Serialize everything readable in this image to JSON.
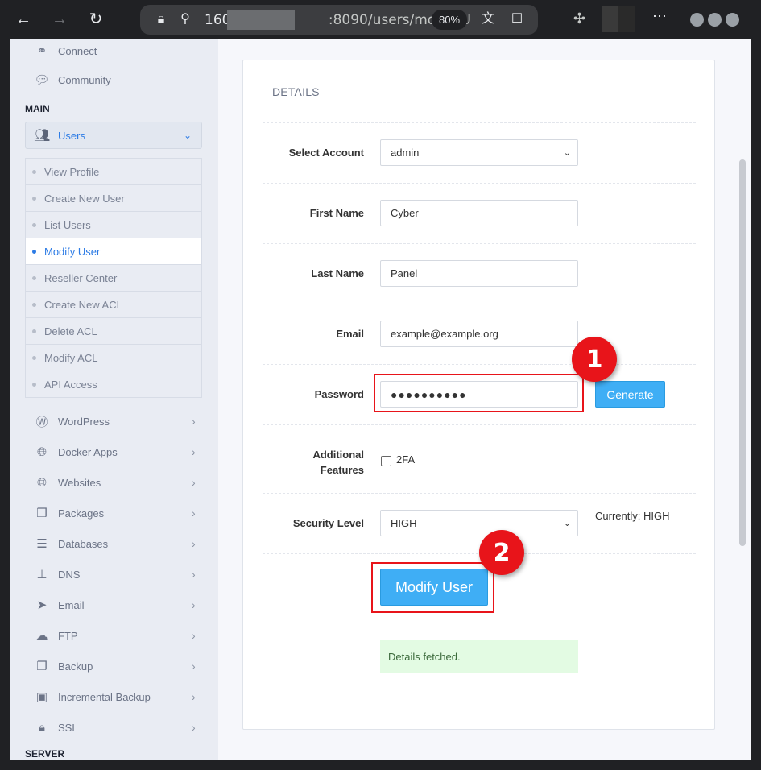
{
  "browser": {
    "url_host": "160.",
    "url_path": ":8090/users/modifyU",
    "zoom": "80%"
  },
  "sidebar": {
    "top_items": [
      {
        "label": "Connect",
        "icon": "link-icon"
      },
      {
        "label": "Community",
        "icon": "comments-icon"
      }
    ],
    "main_label": "MAIN",
    "users": {
      "label": "Users",
      "icon": "users-icon"
    },
    "sub_items": [
      {
        "label": "View Profile",
        "active": false
      },
      {
        "label": "Create New User",
        "active": false
      },
      {
        "label": "List Users",
        "active": false
      },
      {
        "label": "Modify User",
        "active": true
      },
      {
        "label": "Reseller Center",
        "active": false
      },
      {
        "label": "Create New ACL",
        "active": false
      },
      {
        "label": "Delete ACL",
        "active": false
      },
      {
        "label": "Modify ACL",
        "active": false
      },
      {
        "label": "API Access",
        "active": false
      }
    ],
    "menu_items": [
      {
        "label": "WordPress",
        "icon": "wordpress-icon"
      },
      {
        "label": "Docker Apps",
        "icon": "globe-icon"
      },
      {
        "label": "Websites",
        "icon": "globe-icon"
      },
      {
        "label": "Packages",
        "icon": "cubes-icon"
      },
      {
        "label": "Databases",
        "icon": "database-icon"
      },
      {
        "label": "DNS",
        "icon": "sitemap-icon"
      },
      {
        "label": "Email",
        "icon": "paper-plane-icon"
      },
      {
        "label": "FTP",
        "icon": "cloud-upload-icon"
      },
      {
        "label": "Backup",
        "icon": "copy-icon"
      },
      {
        "label": "Incremental Backup",
        "icon": "save-icon"
      },
      {
        "label": "SSL",
        "icon": "lock-icon"
      }
    ],
    "server_label": "SERVER"
  },
  "form": {
    "title": "DETAILS",
    "select_account_label": "Select Account",
    "select_account_value": "admin",
    "first_name_label": "First Name",
    "first_name_value": "Cyber",
    "last_name_label": "Last Name",
    "last_name_value": "Panel",
    "email_label": "Email",
    "email_value": "example@example.org",
    "password_label": "Password",
    "password_value": "●●●●●●●●●●",
    "generate_label": "Generate",
    "additional_label_1": "Additional",
    "additional_label_2": "Features",
    "twofa_label": "2FA",
    "twofa_checked": false,
    "security_label": "Security Level",
    "security_value": "HIGH",
    "currently_text": "Currently: HIGH",
    "modify_button": "Modify User",
    "status_message": "Details fetched."
  },
  "annotations": {
    "marker_1": "1",
    "marker_2": "2",
    "highlight_color": "#e8141a"
  }
}
